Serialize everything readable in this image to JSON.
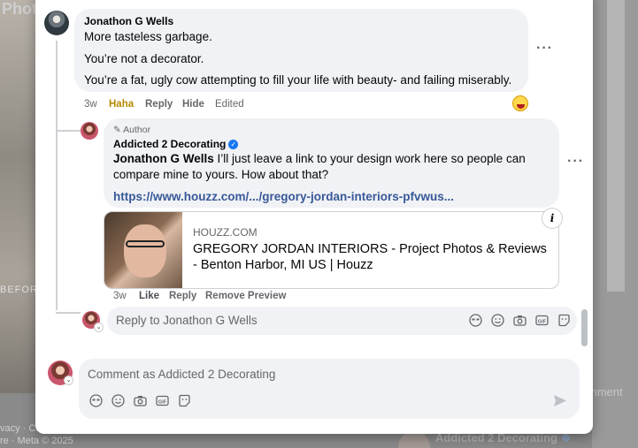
{
  "background": {
    "title_fragment": "Phot",
    "before_label": "BEFORE",
    "footer_line1": "vacy · Co",
    "footer_line2": "re · Meta © 2025",
    "comment_fragment": "mment",
    "author_fragment": "Addicted 2 Decorating"
  },
  "comment1": {
    "author": "Jonathon G Wells",
    "lines": [
      "More tasteless garbage.",
      "You’re not a decorator.",
      "You’re a fat, ugly cow attempting to fill your life with beauty- and failing miserably."
    ],
    "time": "3w",
    "reaction_label": "Haha",
    "actions": [
      "Reply",
      "Hide",
      "Edited"
    ],
    "more": "···"
  },
  "reply": {
    "author_tag": "Author",
    "author": "Addicted 2 Decorating",
    "mention": "Jonathon G Wells",
    "text_line1": " I’ll just leave a link to your design work here so people can",
    "text_line2": "compare mine to yours. How about that?",
    "link": "https://www.houzz.com/.../gregory-jordan-interiors-pfvwus...",
    "more": "···",
    "preview": {
      "domain": "HOUZZ.COM",
      "title": "GREGORY JORDAN INTERIORS - Project Photos & Reviews - Benton Harbor, MI US | Houzz",
      "info_icon": "i"
    },
    "time": "3w",
    "actions": [
      "Like",
      "Reply",
      "Remove Preview"
    ]
  },
  "reply_input": {
    "placeholder": "Reply to Jonathon G Wells"
  },
  "comment_input": {
    "placeholder": "Comment as Addicted 2 Decorating"
  },
  "icons": [
    "avatar-sticker-icon",
    "emoji-icon",
    "camera-icon",
    "gif-icon",
    "sticker-icon",
    "send-icon"
  ]
}
